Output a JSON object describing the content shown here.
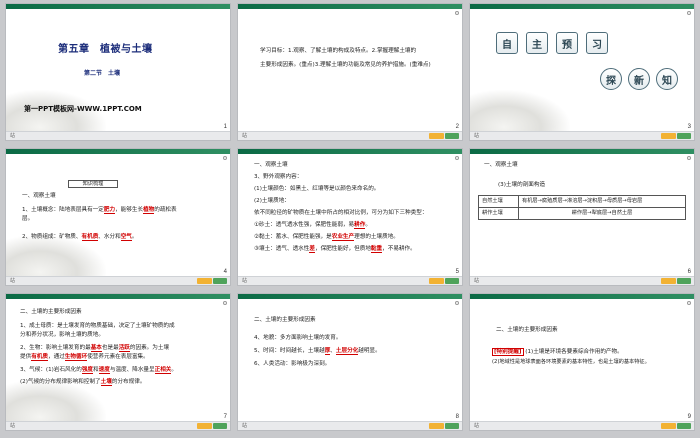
{
  "slides": [
    {
      "num": "1",
      "title": "第五章　植被与土壤",
      "subtitle": "第二节　土壤",
      "brand": "第一PPT模板网-WWW.1PPT.COM"
    },
    {
      "num": "2",
      "goal_lines": [
        "学习目标：1.观察、了解土壤的构成及特点。2.掌握理解土壤的",
        "主要形成因素。(重点)3.理解土壤的功能及常见的养护措施。(重难点)"
      ]
    },
    {
      "num": "3",
      "badges_top": [
        "自",
        "主",
        "预",
        "习"
      ],
      "badges_bottom": [
        "探",
        "新",
        "知"
      ]
    },
    {
      "num": "4",
      "box": "知识梳理",
      "h": "一、观察土壤",
      "l1a": "1、土壤概念：陆地表层具有一定",
      "l1b": "肥力",
      "l1c": "，能够生长",
      "l1d": "植物",
      "l1e": "的疏松表",
      "l1f": "层。",
      "l2a": "2、物质组成：矿物质、",
      "l2b": "有机质",
      "l2c": "、水分和",
      "l2d": "空气",
      "l2e": "。"
    },
    {
      "num": "5",
      "lines": [
        "一、观察土壤",
        "3、野外观察内容：",
        "(1)土壤颜色：如黑土、红壤等是以颜色来命名的。",
        "(2)土壤质地：",
        "依不同粒径的矿物质在土壤中所占的相对比例，可分为如下三种类型："
      ],
      "s1a": "①砂土：透气透水性强，保肥性能弱，易",
      "s1b": "耕作",
      "s1c": "。",
      "s2a": "②黏土：蓄水、保肥性能强，是",
      "s2b": "农业生产",
      "s2c": "理想的土壤质地。",
      "s3a": "③壤土：透气、透水性",
      "s3b": "差",
      "s3c": "，保肥性能好，但质地",
      "s3d": "黏重",
      "s3e": "，不易耕作。"
    },
    {
      "num": "6",
      "h": "一、观察土壤",
      "sub": "(3)土壤的剖面构造",
      "row1_label": "自然土壤",
      "row1_val": "有机层→腐殖质层→淋溶层→淀积层→母质层→母岩层",
      "row2_label": "耕作土壤",
      "row2_val": "耕作层→犁底层→自然土层"
    },
    {
      "num": "7",
      "h": "二、土壤的主要形成因素",
      "p1": "1、成土母质：是土壤发育的物质基础，决定了土壤矿物质的成",
      "p1b": "分和养分状况，影响土壤的质地。",
      "p2a": "2、生物：影响土壤发育的最",
      "p2b": "基本",
      "p2c": "也是最",
      "p2d": "活跃",
      "p2e": "的因素。为土壤",
      "p2f": "提供",
      "p2g": "有机质",
      "p2h": "，通过",
      "p2i": "生物循环",
      "p2j": "使营养元素在表层富集。",
      "p3a": "3、气候：(1)岩石风化的",
      "p3b": "强度",
      "p3c": "和",
      "p3d": "速度",
      "p3e": "与温度、降水量呈",
      "p3f": "正相关",
      "p3g": "。",
      "p4a": "(2)气候的分布规律影响和控制了",
      "p4b": "土壤",
      "p4c": "的分布规律。"
    },
    {
      "num": "8",
      "h": "二、土壤的主要形成因素",
      "p4": "4、地貌：多方面影响土壤的发育。",
      "p5a": "5、时间：时间越长，土壤越",
      "p5b": "厚",
      "p5c": "、",
      "p5d": "土层分化",
      "p5e": "越明显。",
      "p6": "6、人类活动：影响极为深刻。"
    },
    {
      "num": "9",
      "h": "二、土壤的主要形成因素",
      "tag": "[特别提醒]",
      "t1": "(1)土壤是环境各要素综合作用的产物。",
      "t2": "(2)地域性是地球表面各环境要素的基本特性，也是土壤的基本特征。"
    }
  ],
  "footer": {
    "left": "站",
    "right": "栏目导航"
  },
  "colors": {
    "accent": "#0b6a45",
    "highlight": "#d10000",
    "title": "#1b2c7a"
  }
}
